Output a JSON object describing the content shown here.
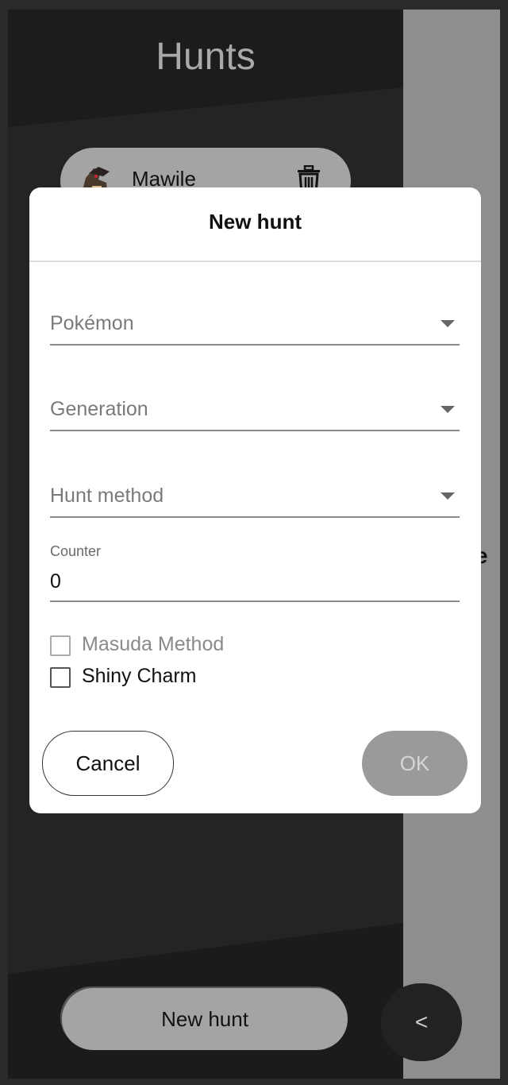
{
  "sidebar": {
    "title": "Hunts",
    "hunts": [
      {
        "name": "Mawile",
        "sprite_icon": "mawile-sprite-icon",
        "delete_icon": "trash-icon"
      }
    ],
    "new_hunt_label": "New hunt",
    "toggle_label": "<"
  },
  "main": {
    "partial_text": "re"
  },
  "dialog": {
    "title": "New hunt",
    "pokemon": {
      "label": "Pokémon",
      "value": ""
    },
    "generation": {
      "label": "Generation",
      "value": ""
    },
    "method": {
      "label": "Hunt method",
      "value": ""
    },
    "counter": {
      "label": "Counter",
      "value": "0"
    },
    "masuda": {
      "label": "Masuda Method",
      "checked": false,
      "disabled": true
    },
    "shiny_charm": {
      "label": "Shiny Charm",
      "checked": false,
      "disabled": false
    },
    "cancel_label": "Cancel",
    "ok_label": "OK"
  },
  "colors": {
    "sidebar_bg": "#242424",
    "panel_grey": "#8e8e8e",
    "pill_grey": "#a4a4a4",
    "ok_disabled": "#9a9a9a"
  }
}
